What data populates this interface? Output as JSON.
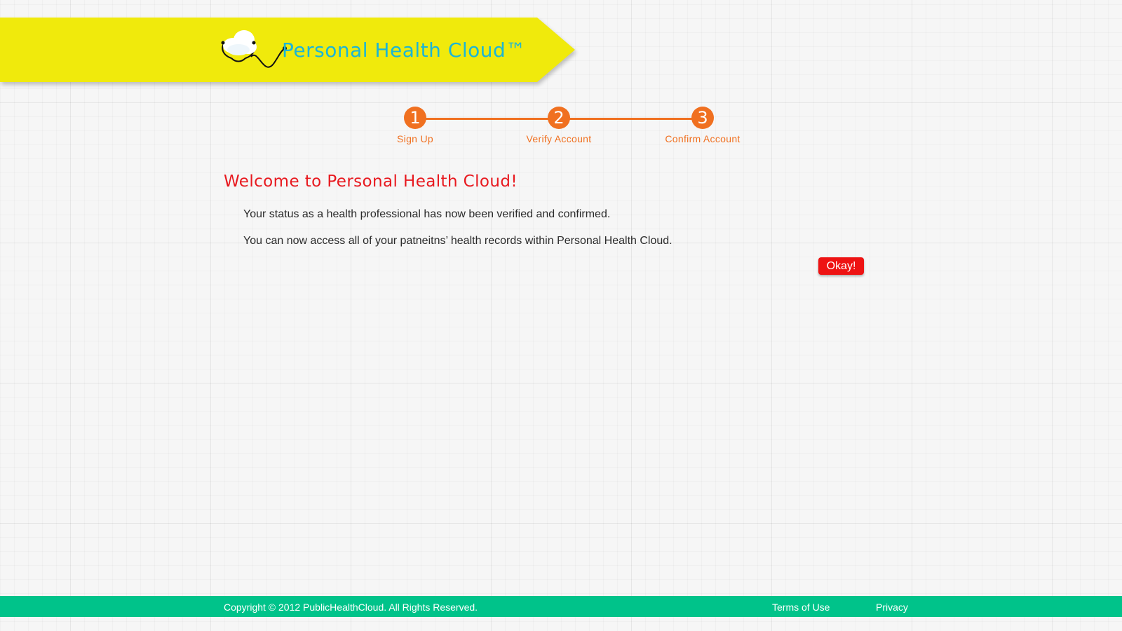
{
  "header": {
    "brand": "Personal Health Cloud™",
    "ribbon_color": "#f0ea0c",
    "brand_color": "#1bb5d6"
  },
  "stepper": {
    "accent_color": "#f07020",
    "steps": [
      {
        "number": "1",
        "label": "Sign Up"
      },
      {
        "number": "2",
        "label": "Verify Account"
      },
      {
        "number": "3",
        "label": "Confirm Account"
      }
    ]
  },
  "main": {
    "heading": "Welcome to Personal Health Cloud!",
    "messages": [
      "Your status as a health professional has now been verified and confirmed.",
      "You can now access all of your patneitns’ health records within Personal Health Cloud."
    ],
    "okay_label": "Okay!",
    "heading_color": "#e8191f",
    "button_color": "#ee1313"
  },
  "footer": {
    "copyright": "Copyright © 2012 PublicHealthCloud. All Rights Reserved.",
    "links": [
      "Terms of Use",
      "Privacy"
    ],
    "background_color": "#00c38a"
  },
  "icons": {
    "logo": "cloud-stethoscope-icon"
  }
}
